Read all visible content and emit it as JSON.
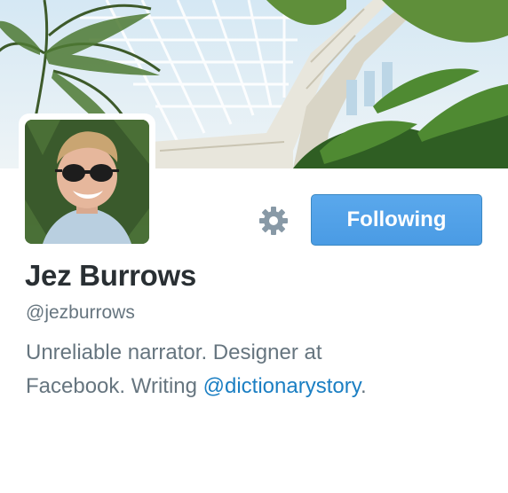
{
  "profile": {
    "name": "Jez Burrows",
    "handle": "@jezburrows",
    "bio_line1": "Unreliable narrator. Designer at",
    "bio_line2_prefix": "Facebook. Writing ",
    "bio_link": "@dictionarystory",
    "bio_suffix": "."
  },
  "actions": {
    "settings_icon": "gear-icon",
    "follow_label": "Following"
  },
  "colors": {
    "follow_button": "#4a9be4",
    "link": "#1b7fc3",
    "name_text": "#292f33",
    "secondary_text": "#66757f",
    "gear": "#8899a6"
  }
}
